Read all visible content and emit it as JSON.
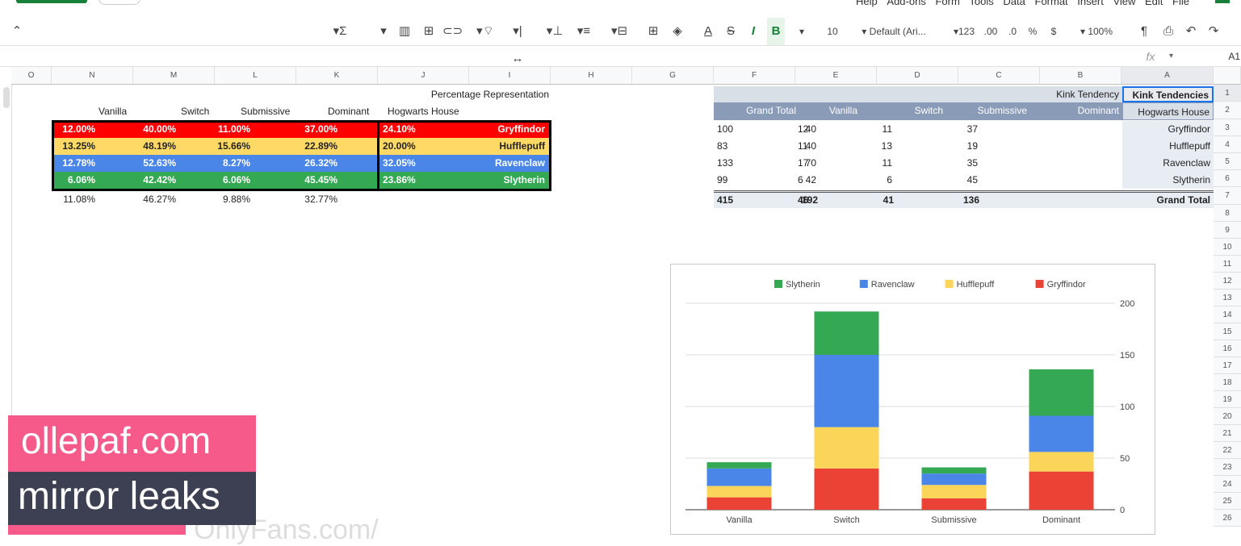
{
  "menu": {
    "items": [
      "File",
      "Edit",
      "View",
      "Insert",
      "Format",
      "Data",
      "Tools",
      "Form",
      "Add-ons",
      "Help"
    ]
  },
  "toolbar": {
    "zoom": "100%",
    "currency": "$",
    "percent": "%",
    "decrease_decimals": ".0",
    "increase_decimals": ".00",
    "more_formats": "123",
    "font": "Default (Ari...",
    "font_size": "10",
    "bold": "B",
    "italic": "I",
    "strikethrough": "S",
    "text_color": "A"
  },
  "formula_bar": {
    "cell_ref": "A1",
    "fx": "fx"
  },
  "columns": [
    "A",
    "B",
    "C",
    "D",
    "E",
    "F",
    "G",
    "H",
    "I",
    "J",
    "K",
    "L",
    "M",
    "N",
    "O"
  ],
  "rows": [
    "1",
    "2",
    "3",
    "4",
    "5",
    "6",
    "7",
    "8",
    "9",
    "10",
    "11",
    "12",
    "13",
    "14",
    "15",
    "16",
    "17",
    "18",
    "19",
    "20",
    "21",
    "22",
    "23",
    "24",
    "25",
    "26"
  ],
  "pivot": {
    "title": "Kink Tendencies",
    "title_value": "Kink Tendency",
    "row_header": "Hogwarts House",
    "col_headers": [
      "Dominant",
      "Submissive",
      "Switch",
      "Vanilla",
      "Grand Total"
    ],
    "rows": [
      {
        "house": "Gryffindor",
        "values": [
          "37",
          "11",
          "40",
          "12",
          "100"
        ]
      },
      {
        "house": "Hufflepuff",
        "values": [
          "19",
          "13",
          "40",
          "11",
          "83"
        ]
      },
      {
        "house": "Ravenclaw",
        "values": [
          "35",
          "11",
          "70",
          "17",
          "133"
        ]
      },
      {
        "house": "Slytherin",
        "values": [
          "45",
          "6",
          "42",
          "6",
          "99"
        ]
      }
    ],
    "total": {
      "label": "Grand Total",
      "values": [
        "136",
        "41",
        "192",
        "46",
        "415"
      ]
    }
  },
  "percentage": {
    "title": "Percentage Representation",
    "row_header": "Hogwarts House",
    "col_headers": [
      "Dominant",
      "Submissive",
      "Switch",
      "Vanilla"
    ],
    "rows": [
      {
        "house": "Gryffindor",
        "color": "#ff0000",
        "values": [
          "24.10%",
          "37.00%",
          "11.00%",
          "40.00%",
          "12.00%"
        ]
      },
      {
        "house": "Hufflepuff",
        "color": "#ffd966",
        "values": [
          "20.00%",
          "22.89%",
          "15.66%",
          "48.19%",
          "13.25%"
        ]
      },
      {
        "house": "Ravenclaw",
        "color": "#4a86e8",
        "values": [
          "32.05%",
          "26.32%",
          "8.27%",
          "52.63%",
          "12.78%"
        ]
      },
      {
        "house": "Slytherin",
        "color": "#34a853",
        "values": [
          "23.86%",
          "45.45%",
          "6.06%",
          "42.42%",
          "6.06%"
        ]
      }
    ],
    "totals": [
      "32.77%",
      "9.88%",
      "46.27%",
      "11.08%"
    ]
  },
  "chart_data": {
    "type": "bar",
    "stacked": true,
    "categories": [
      "Dominant",
      "Submissive",
      "Switch",
      "Vanilla"
    ],
    "series": [
      {
        "name": "Gryffindor",
        "color": "#ea4335",
        "values": [
          37,
          11,
          40,
          12
        ]
      },
      {
        "name": "Hufflepuff",
        "color": "#fbd45a",
        "values": [
          19,
          13,
          40,
          11
        ]
      },
      {
        "name": "Ravenclaw",
        "color": "#4a86e8",
        "values": [
          35,
          11,
          70,
          17
        ]
      },
      {
        "name": "Slytherin",
        "color": "#34a853",
        "values": [
          45,
          6,
          42,
          6
        ]
      }
    ],
    "yticks": [
      "0",
      "50",
      "100",
      "150",
      "200"
    ],
    "ylim": [
      0,
      200
    ],
    "legend": "top",
    "grid": true,
    "mirrored": true
  },
  "watermark": {
    "line1": "ollepaf.com",
    "line2": "mirror leaks"
  }
}
